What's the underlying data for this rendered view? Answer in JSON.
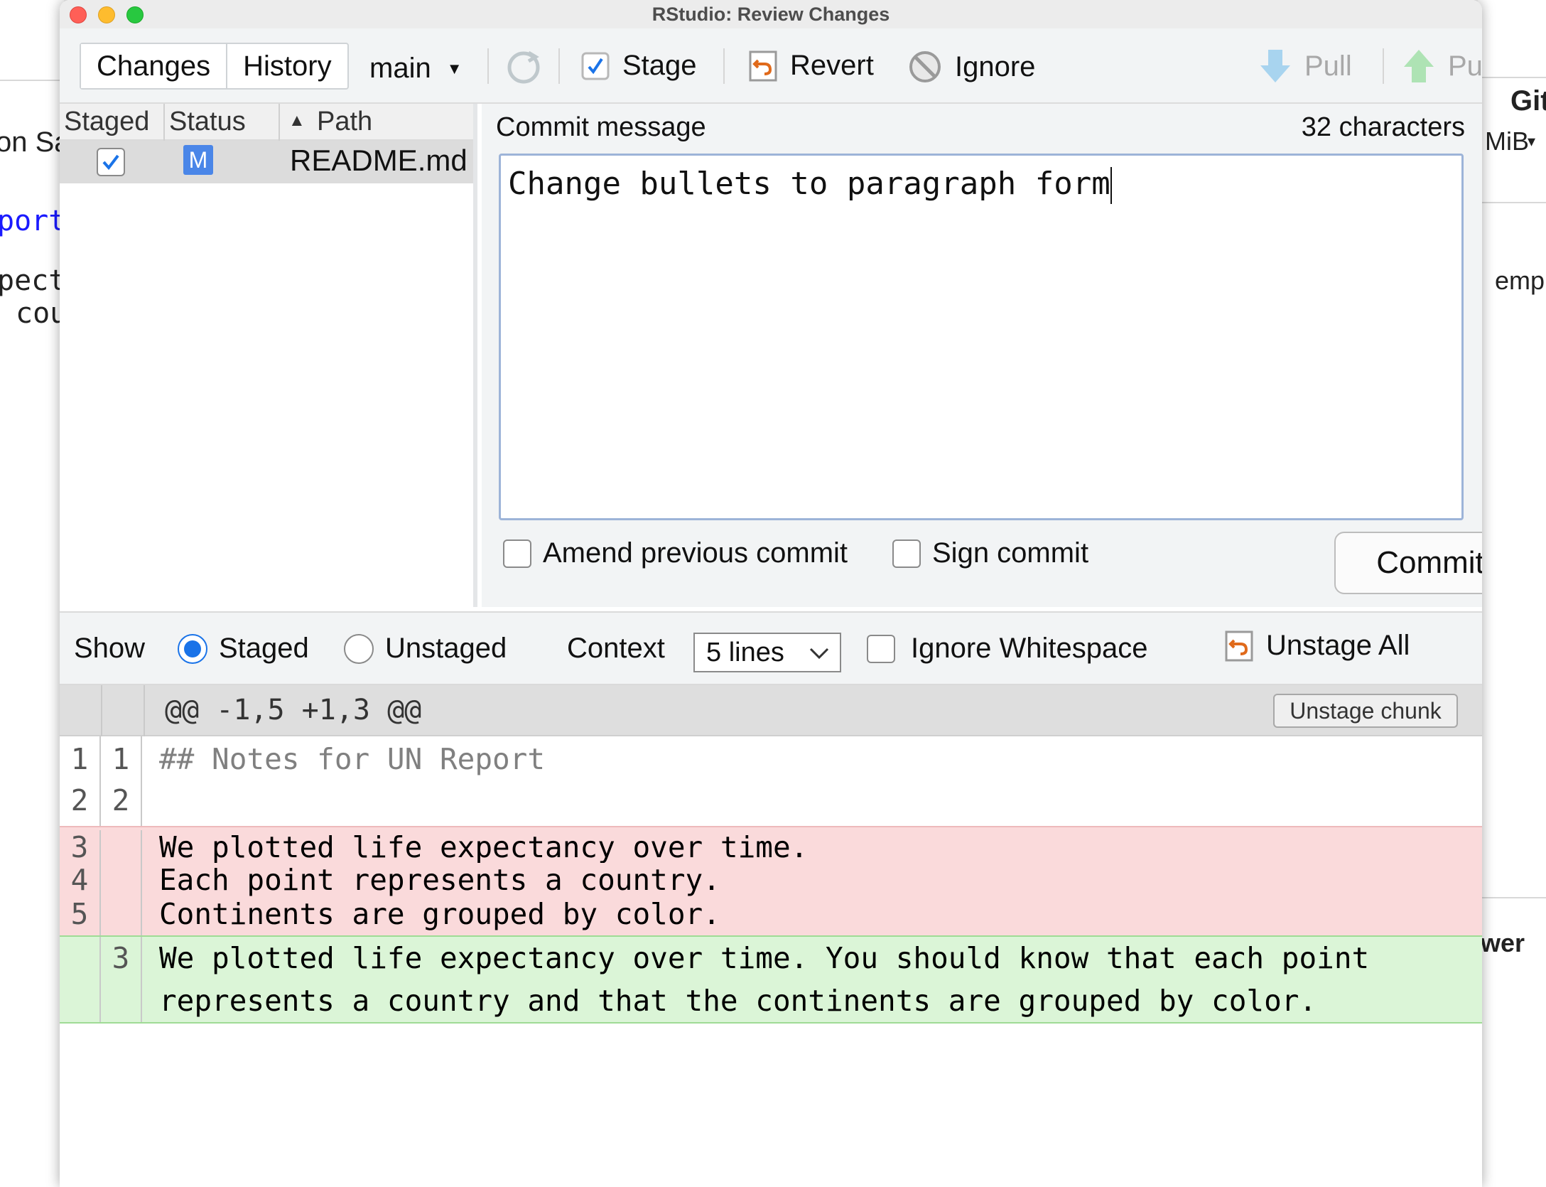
{
  "background": {
    "left_fragments": [
      "on Sa",
      "port",
      "pect",
      "cou"
    ],
    "right_fragments": [
      "Git",
      "MiB",
      "emp",
      "wer"
    ]
  },
  "window": {
    "title": "RStudio: Review Changes"
  },
  "toolbar": {
    "tabs": [
      {
        "label": "Changes",
        "selected": true
      },
      {
        "label": "History",
        "selected": false
      }
    ],
    "branch": "main",
    "stage_label": "Stage",
    "revert_label": "Revert",
    "ignore_label": "Ignore",
    "pull_label": "Pull",
    "push_label": "Push"
  },
  "files": {
    "columns": [
      "Staged",
      "Status",
      "Path"
    ],
    "rows": [
      {
        "staged": true,
        "status": "M",
        "path": "README.md"
      }
    ]
  },
  "commit": {
    "label": "Commit message",
    "char_count": "32 characters",
    "message": "Change bullets to paragraph form",
    "amend_label": "Amend previous commit",
    "sign_label": "Sign commit",
    "commit_label": "Commit"
  },
  "show_bar": {
    "show_label": "Show",
    "staged_label": "Staged",
    "unstaged_label": "Unstaged",
    "selected": "Staged",
    "context_label": "Context",
    "context_value": "5 lines",
    "ignore_ws_label": "Ignore Whitespace",
    "unstage_all_label": "Unstage All"
  },
  "diff": {
    "hunk_header": "@@ -1,5 +1,3 @@",
    "unstage_chunk_label": "Unstage chunk",
    "lines": [
      {
        "type": "context",
        "old": "1",
        "new": "1",
        "text": "## Notes for UN Report"
      },
      {
        "type": "context",
        "old": "2",
        "new": "2",
        "text": ""
      },
      {
        "type": "deleted",
        "old": "3",
        "new": "",
        "text": "We plotted life expectancy over time."
      },
      {
        "type": "deleted",
        "old": "4",
        "new": "",
        "text": "Each point represents a country."
      },
      {
        "type": "deleted",
        "old": "5",
        "new": "",
        "text": "Continents are grouped by color."
      },
      {
        "type": "added",
        "old": "",
        "new": "3",
        "text": "We plotted life expectancy over time. You should know that each point represents a country and that the continents are grouped by color."
      }
    ]
  },
  "colors": {
    "deleted_bg": "#fadadb",
    "added_bg": "#dbf5d7",
    "radio_accent": "#1a73e8",
    "status_modified": "#4a86e8"
  }
}
